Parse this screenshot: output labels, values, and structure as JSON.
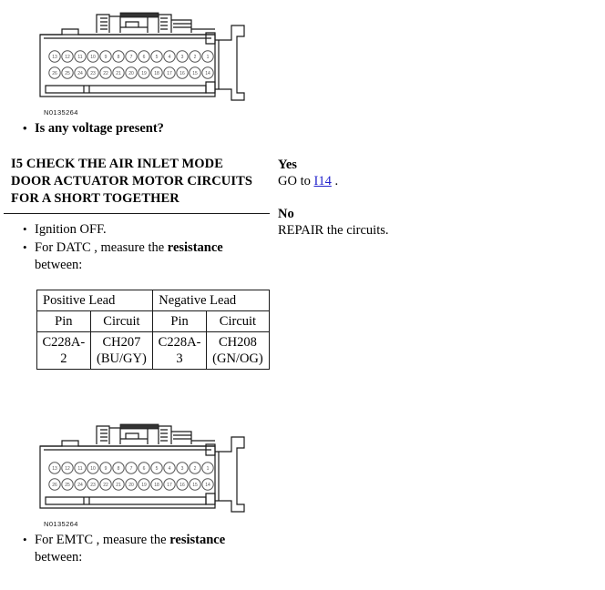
{
  "document": {
    "type": "vehicle-diagnostic-pinpoint-test",
    "step": {
      "id": "I5",
      "title": "I5 CHECK THE AIR INLET MODE DOOR ACTUATOR MOTOR CIRCUITS FOR A SHORT TOGETHER"
    },
    "top_section": {
      "figure_caption": "N0135264",
      "question": "Is any voltage present?"
    },
    "instructions": [
      "Ignition OFF.",
      "For DATC , measure the resistance between:"
    ],
    "instruction_parts": {
      "item1": "Ignition OFF.",
      "item2_pre": "For DATC , measure the ",
      "item2_bold": "resistance",
      "item2_post": "between:"
    },
    "measurement_table": {
      "group_headers": [
        "Positive Lead",
        "Negative Lead"
      ],
      "column_headers": [
        "Pin",
        "Circuit",
        "Pin",
        "Circuit"
      ],
      "rows": [
        {
          "positive_pin": "C228A-2",
          "positive_circuit": "CH207 (BU/GY)",
          "negative_pin": "C228A-3",
          "negative_circuit": "CH208 (GN/OG)"
        }
      ]
    },
    "bottom_section": {
      "figure_caption": "N0135264",
      "instruction_pre": "For EMTC , measure the ",
      "instruction_bold": "resistance",
      "instruction_post": "between:"
    },
    "answers": [
      {
        "label": "Yes",
        "text_pre": "GO to ",
        "link": "I14",
        "text_post": " ."
      },
      {
        "label": "No",
        "text_pre": "REPAIR the circuits.",
        "link": "",
        "text_post": ""
      }
    ],
    "colors": {
      "rule": "#1a1a1a",
      "link": "#2222cc",
      "text": "#000000",
      "background": "#ffffff"
    }
  }
}
